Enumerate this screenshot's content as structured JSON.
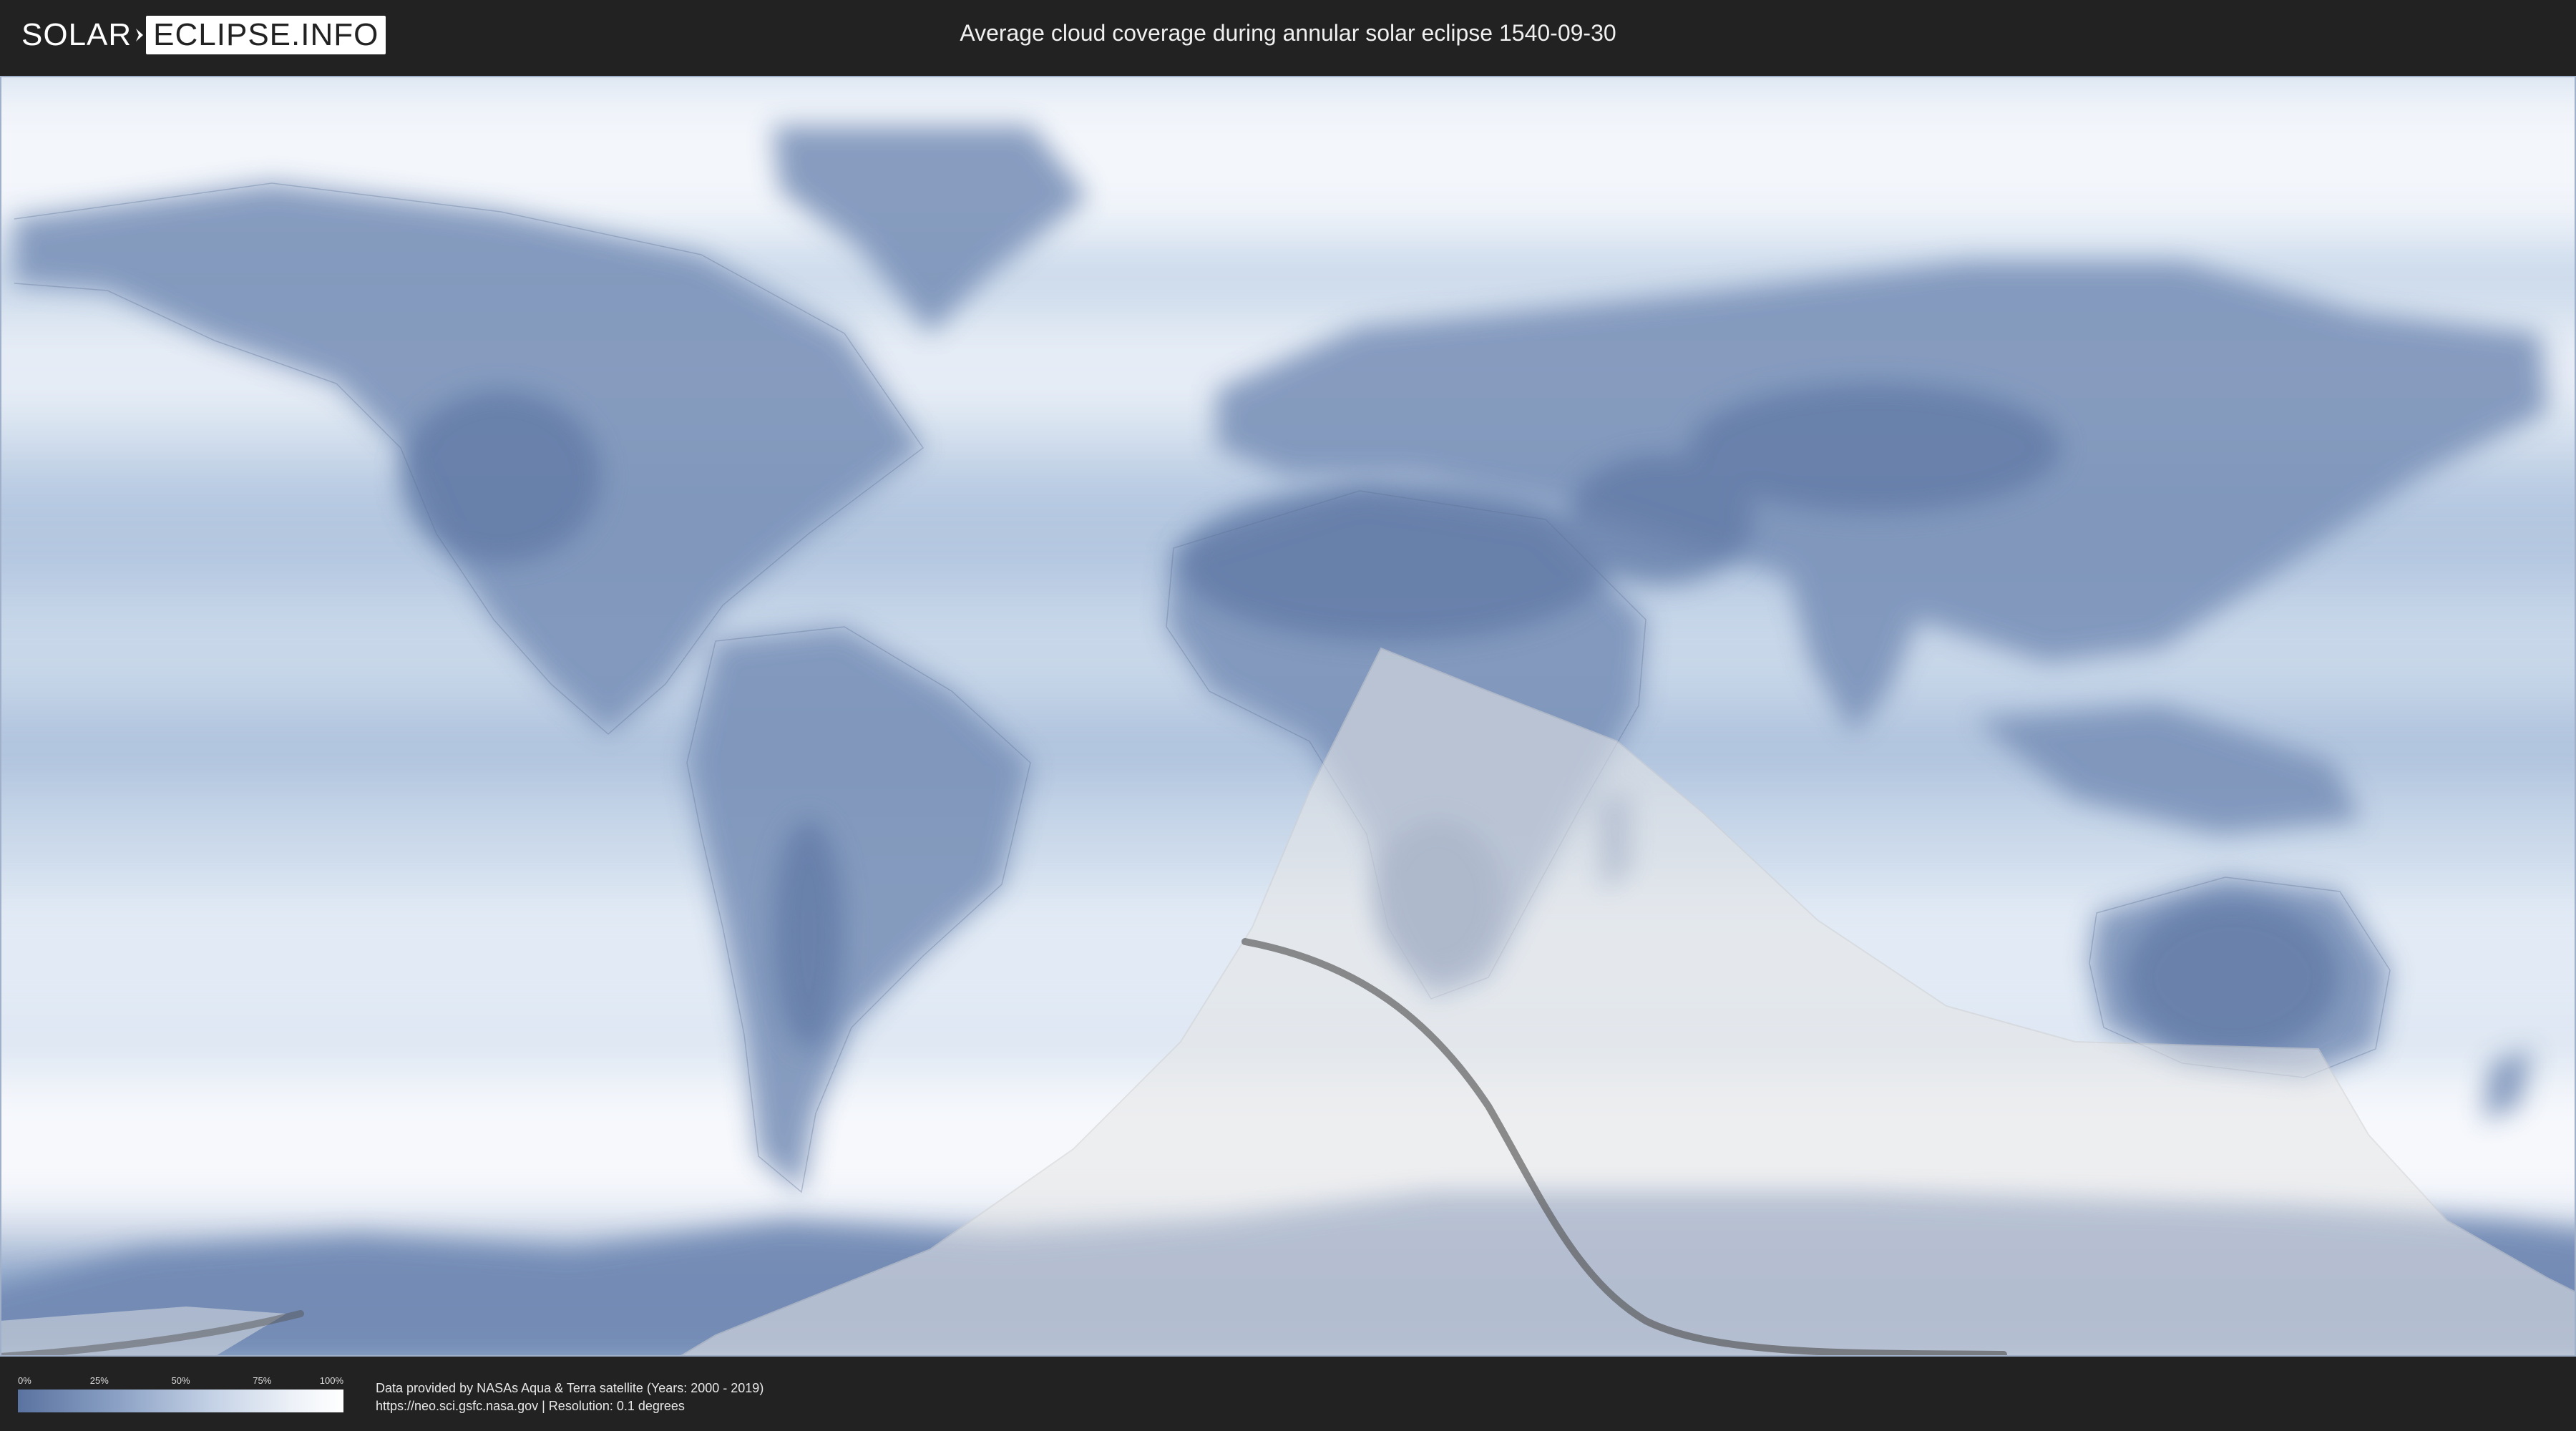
{
  "header": {
    "logo_left": "SOLAR",
    "logo_right": "ECLIPSE.INFO",
    "title": "Average cloud coverage during annular solar eclipse 1540-09-30"
  },
  "legend": {
    "ticks": [
      "0%",
      "25%",
      "50%",
      "75%",
      "100%"
    ],
    "gradient_start": "#5a73a0",
    "gradient_end": "#ffffff"
  },
  "credits": {
    "line1": "Data provided by NASAs Aqua & Terra satellite (Years: 2000 - 2019)",
    "line2": "https://neo.sci.gsfc.nasa.gov | Resolution: 0.1 degrees"
  },
  "map": {
    "land_color": "#6f86ae",
    "cloud_color": "#ffffff",
    "eclipse_overlay_color": "#e6e6e6",
    "eclipse_path_color": "#555555"
  }
}
